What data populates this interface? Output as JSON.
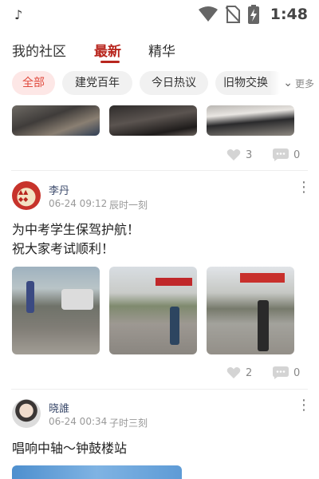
{
  "status_bar": {
    "app_icon": "tiktok-icon",
    "time": "1:48",
    "icons": [
      "wifi-icon",
      "no-sim-icon",
      "battery-charging-icon"
    ]
  },
  "tabs": [
    {
      "label": "我的社区",
      "active": false
    },
    {
      "label": "最新",
      "active": true
    },
    {
      "label": "精华",
      "active": false
    }
  ],
  "chips": [
    {
      "label": "全部",
      "active": true
    },
    {
      "label": "建党百年",
      "active": false
    },
    {
      "label": "今日热议",
      "active": false
    },
    {
      "label": "旧物交换",
      "active": false
    }
  ],
  "more_label": "更多",
  "colors": {
    "accent": "#b8261e",
    "chip_active_bg": "#fde7e6",
    "chip_active_text": "#e04a3e"
  },
  "posts": [
    {
      "likes": "3",
      "comments": "0"
    },
    {
      "author": "李丹",
      "date": "06-24 09:12",
      "shichen": "辰时一刻",
      "lines": [
        "为中考学生保驾护航！",
        "祝大家考试顺利！"
      ],
      "likes": "2",
      "comments": "0"
    },
    {
      "author": "晓誰",
      "date": "06-24 00:34",
      "shichen": "子时三刻",
      "lines": [
        "唱响中轴～钟鼓楼站"
      ]
    }
  ]
}
